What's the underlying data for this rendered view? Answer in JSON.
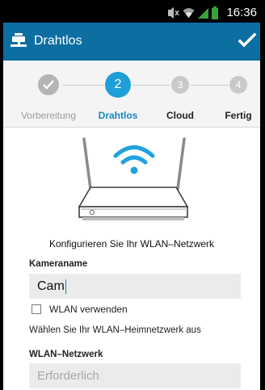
{
  "status_bar": {
    "time": "16:36",
    "icons": [
      "mute-icon",
      "wifi-icon",
      "signal-icon",
      "battery-icon"
    ]
  },
  "action_bar": {
    "title": "Drahtlos",
    "app_icon": "camera-icon",
    "confirm_icon": "checkmark-icon"
  },
  "stepper": {
    "steps": [
      {
        "label": "Vorbereitung",
        "number": "",
        "state": "done"
      },
      {
        "label": "Drahtlos",
        "number": "2",
        "state": "active"
      },
      {
        "label": "Cloud",
        "number": "3",
        "state": "pending"
      },
      {
        "label": "Fertig",
        "number": "4",
        "state": "pending"
      }
    ]
  },
  "main": {
    "illustration": "wifi-router-icon",
    "heading": "Konfigurieren Sie Ihr WLAN–Netzwerk",
    "camera_name": {
      "label": "Kameraname",
      "value": "Cam"
    },
    "use_wlan": {
      "label": "WLAN verwenden",
      "checked": false
    },
    "info_text": "Wählen Sie Ihr WLAN–Heimnetzwerk aus",
    "network": {
      "label": "WLAN–Netzwerk",
      "placeholder": "Erforderlich"
    }
  },
  "colors": {
    "action_bar": "#0d6ea2",
    "active_step": "#1e9fd8",
    "done_step": "#b5b5b5",
    "pending_step": "#c9c9c9",
    "active_label": "#1a86c2",
    "wifi_blue": "#1fa2df"
  }
}
